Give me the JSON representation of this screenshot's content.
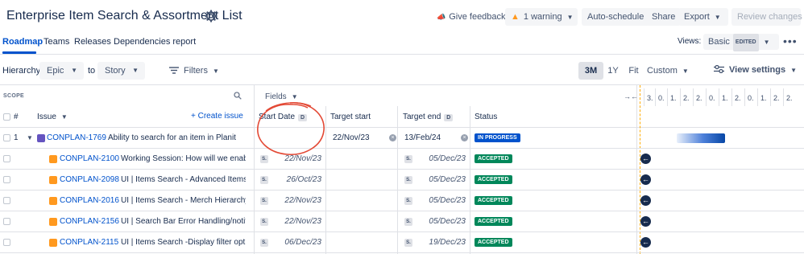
{
  "header": {
    "title": "Enterprise Item Search & Assortment List",
    "give_feedback": "Give feedback",
    "warning": "1 warning",
    "auto_schedule": "Auto-schedule",
    "share": "Share",
    "export": "Export",
    "review_changes": "Review changes"
  },
  "tabs": {
    "items": [
      "Roadmap",
      "Teams",
      "Releases",
      "Dependencies report"
    ],
    "active": "Roadmap",
    "views_label": "Views:",
    "views_value": "Basic",
    "views_badge": "EDITED"
  },
  "toolbar": {
    "hierarchy_label": "Hierarchy:",
    "from": "Epic",
    "to_label": "to",
    "to": "Story",
    "filters": "Filters",
    "ranges": [
      "3M",
      "1Y",
      "Fit",
      "Custom"
    ],
    "active_range": "3M",
    "view_settings": "View settings"
  },
  "table": {
    "scope_label": "SCOPE",
    "fields_label": "Fields",
    "headers": {
      "num": "#",
      "issue": "Issue",
      "create": "+ Create issue",
      "start_date": "Start Date",
      "start_badge": "D",
      "target_start": "Target start",
      "target_end": "Target end",
      "end_badge": "D",
      "status": "Status"
    },
    "timeline_headers": [
      "3.",
      "0.",
      "1.",
      "2.",
      "2.",
      "0.",
      "1.",
      "2.",
      "0.",
      "1.",
      "2.",
      "2."
    ],
    "rows": [
      {
        "num": "1",
        "key": "CONPLAN-1769",
        "summary": "Ability to search for an item in Planit",
        "start_date": "",
        "target_start": "22/Nov/23",
        "target_end": "13/Feb/24",
        "status": "IN PROGRESS",
        "type": "epic"
      },
      {
        "num": "",
        "key": "CONPLAN-2100",
        "summary": "Working Session: How will we enabl...",
        "start_date": "22/Nov/23",
        "target_start": "",
        "target_end": "05/Dec/23",
        "status": "ACCEPTED",
        "type": "story"
      },
      {
        "num": "",
        "key": "CONPLAN-2098",
        "summary": "UI | Items Search - Advanced Items...",
        "start_date": "26/Oct/23",
        "target_start": "",
        "target_end": "05/Dec/23",
        "status": "ACCEPTED",
        "type": "story"
      },
      {
        "num": "",
        "key": "CONPLAN-2016",
        "summary": "UI | Items Search - Merch Hierarchy...",
        "start_date": "22/Nov/23",
        "target_start": "",
        "target_end": "05/Dec/23",
        "status": "ACCEPTED",
        "type": "story"
      },
      {
        "num": "",
        "key": "CONPLAN-2156",
        "summary": "UI | Search Bar Error Handling/notifi...",
        "start_date": "22/Nov/23",
        "target_start": "",
        "target_end": "05/Dec/23",
        "status": "ACCEPTED",
        "type": "story"
      },
      {
        "num": "",
        "key": "CONPLAN-2115",
        "summary": "UI | Items Search -Display filter opt...",
        "start_date": "06/Dec/23",
        "target_start": "",
        "target_end": "19/Dec/23",
        "status": "ACCEPTED",
        "type": "story"
      }
    ],
    "source_badge": "S."
  },
  "colors": {
    "link": "#0052cc",
    "in_progress": "#0052cc",
    "accepted": "#00875a",
    "epic": "#6554c0",
    "story": "#ff991f",
    "annotation": "#e34935"
  }
}
